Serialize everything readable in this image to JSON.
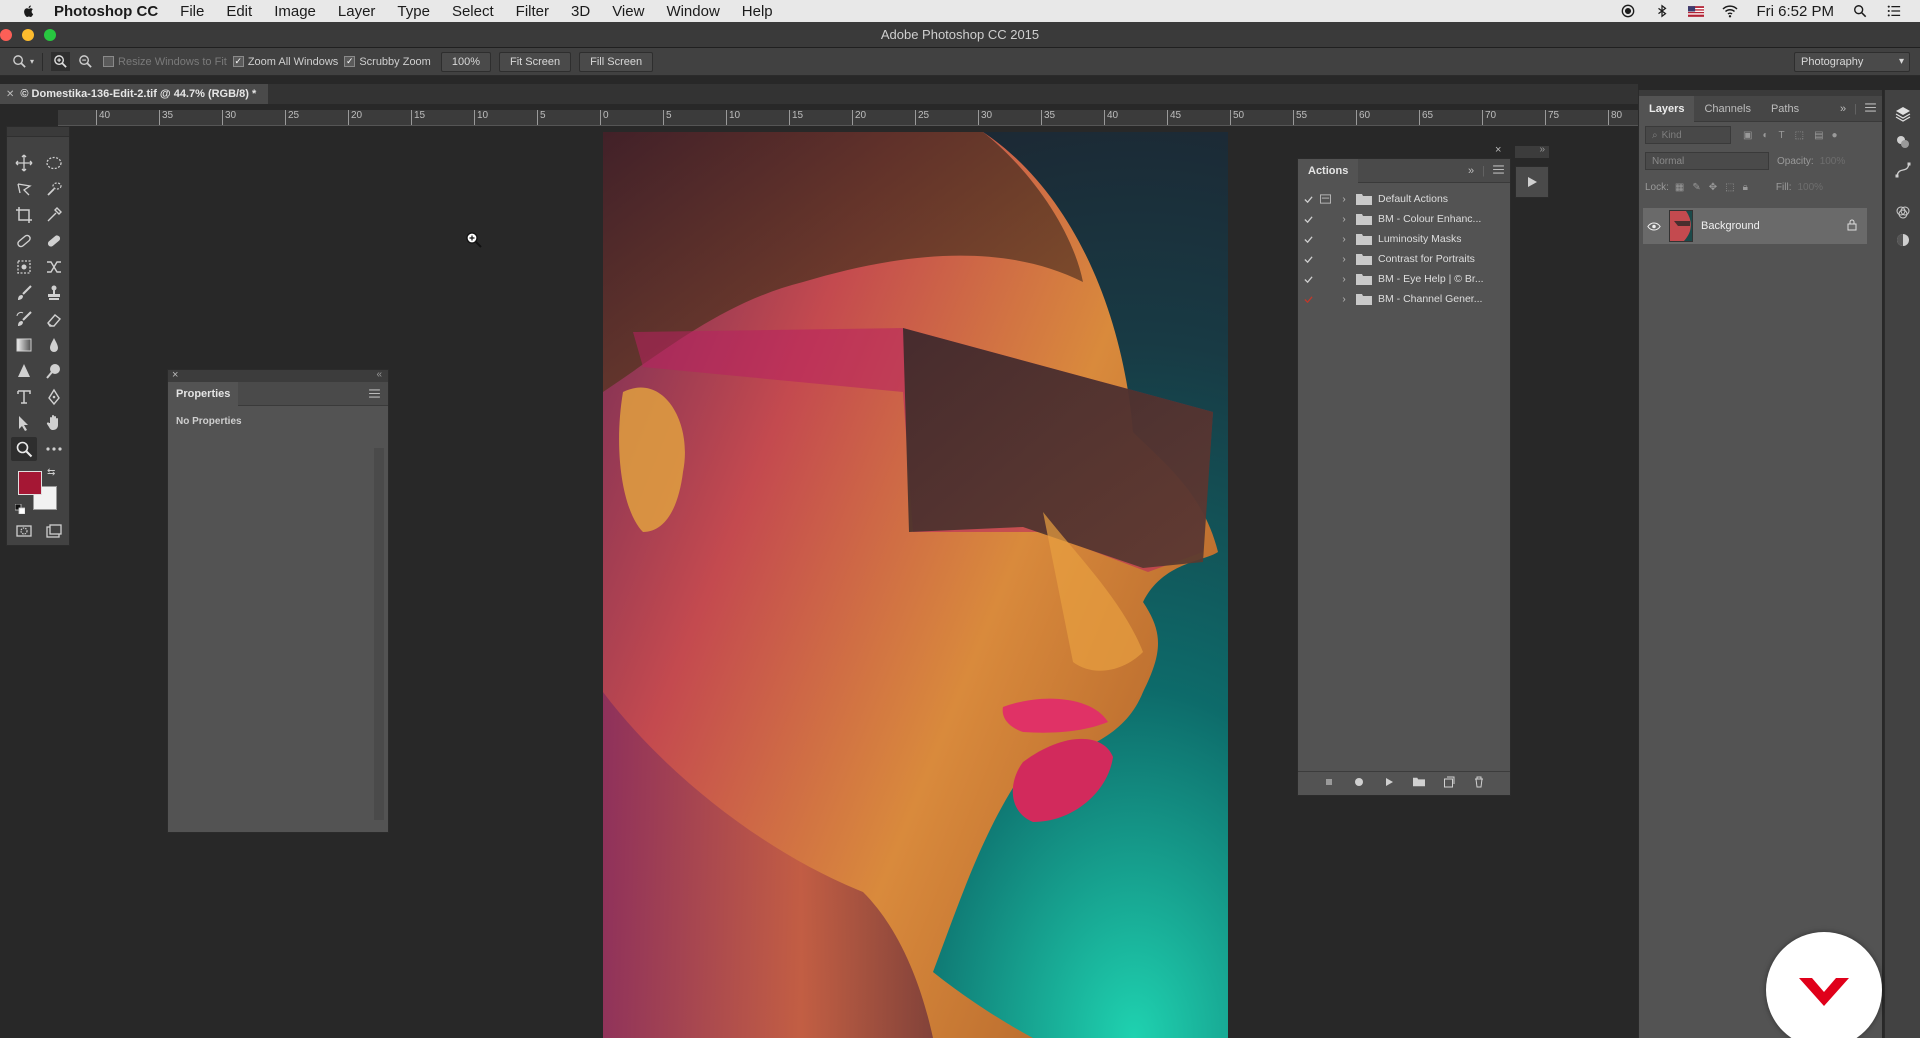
{
  "menubar": {
    "app_name": "Photoshop CC",
    "items": [
      "File",
      "Edit",
      "Image",
      "Layer",
      "Type",
      "Select",
      "Filter",
      "3D",
      "View",
      "Window",
      "Help"
    ],
    "clock": "Fri 6:52 PM",
    "status_icons": [
      "record-icon",
      "bluetooth-icon",
      "flag-icon",
      "wifi-icon",
      "spotlight-search-icon",
      "notification-list-icon"
    ]
  },
  "window": {
    "title": "Adobe Photoshop CC 2015",
    "traffic_colors": [
      "#fc5f57",
      "#fdbc2e",
      "#28c840"
    ]
  },
  "options": {
    "resize_windows": "Resize Windows to Fit",
    "zoom_all_windows": "Zoom All Windows",
    "scrubby_zoom": "Scrubby Zoom",
    "zoom_100": "100%",
    "fit_screen": "Fit Screen",
    "fill_screen": "Fill Screen",
    "workspace": "Photography"
  },
  "document": {
    "tab_title": "© Domestika-136-Edit-2.tif @ 44.7% (RGB/8) *",
    "ruler_labels": [
      "40",
      "35",
      "30",
      "25",
      "20",
      "15",
      "10",
      "5",
      "0",
      "5",
      "10",
      "15",
      "20",
      "25",
      "30",
      "35",
      "40",
      "45",
      "50",
      "55",
      "60",
      "65",
      "70",
      "75",
      "80"
    ]
  },
  "tools": {
    "foreground_color": "#a51734",
    "background_color": "#f2f2f2"
  },
  "properties_panel": {
    "tab": "Properties",
    "empty_text": "No Properties"
  },
  "actions_panel": {
    "tab": "Actions",
    "sets": [
      {
        "label": "Default Actions",
        "check_color": "#cfcfcf"
      },
      {
        "label": "BM - Colour Enhanc...",
        "check_color": "#cfcfcf"
      },
      {
        "label": "Luminosity Masks",
        "check_color": "#cfcfcf"
      },
      {
        "label": "Contrast for Portraits",
        "check_color": "#cfcfcf"
      },
      {
        "label": "BM - Eye Help | © Br...",
        "check_color": "#cfcfcf"
      },
      {
        "label": "BM - Channel Gener...",
        "check_color": "#c0392b"
      }
    ]
  },
  "layers_panel": {
    "tabs": [
      "Layers",
      "Channels",
      "Paths"
    ],
    "kind_placeholder": "Kind",
    "blend_mode": "Normal",
    "opacity_label": "Opacity:",
    "opacity_value": "100%",
    "lock_label": "Lock:",
    "fill_label": "Fill:",
    "fill_value": "100%",
    "layers": [
      {
        "name": "Background",
        "locked": true,
        "visible": true
      }
    ]
  },
  "accent": {
    "domestika_red": "#e0001a"
  }
}
